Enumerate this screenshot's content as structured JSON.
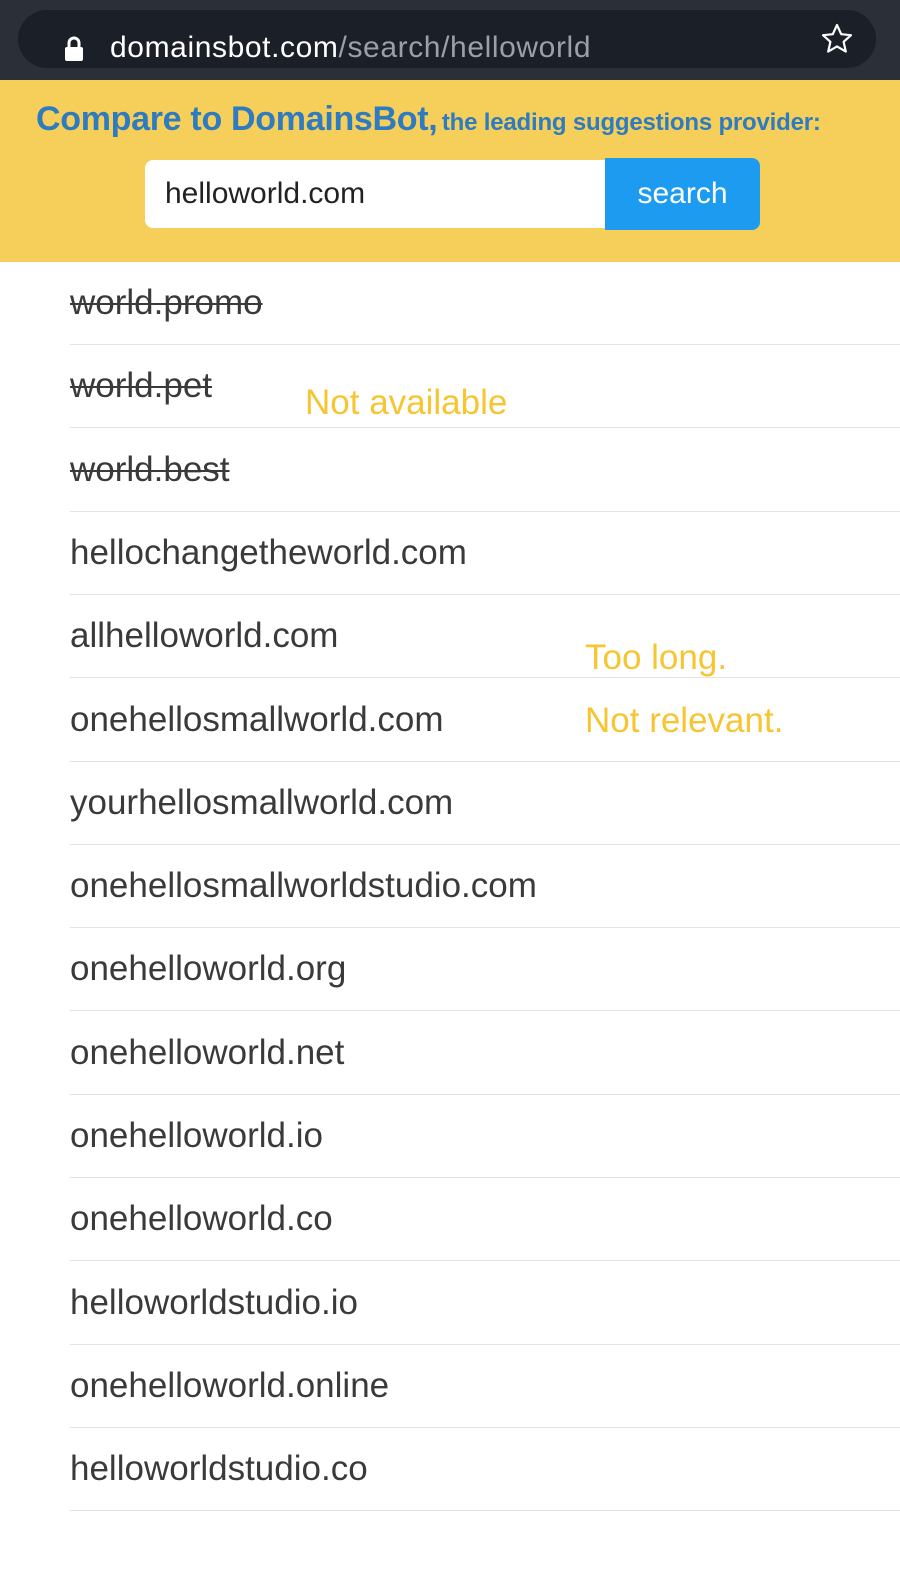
{
  "browser": {
    "url_domain": "domainsbot.com",
    "url_path": "/search/helloworld"
  },
  "banner": {
    "heading_main": "Compare to DomainsBot,",
    "heading_sub": "the leading suggestions provider:",
    "search_value": "helloworld.com",
    "search_button_label": "search"
  },
  "results": [
    {
      "text": "world.promo",
      "struck": true
    },
    {
      "text": "world.pet",
      "struck": true
    },
    {
      "text": "world.best",
      "struck": true
    },
    {
      "text": "hellochangetheworld.com",
      "struck": false
    },
    {
      "text": "allhelloworld.com",
      "struck": false
    },
    {
      "text": "onehellosmallworld.com",
      "struck": false
    },
    {
      "text": "yourhellosmallworld.com",
      "struck": false
    },
    {
      "text": "onehellosmallworldstudio.com",
      "struck": false
    },
    {
      "text": "onehelloworld.org",
      "struck": false
    },
    {
      "text": "onehelloworld.net",
      "struck": false
    },
    {
      "text": "onehelloworld.io",
      "struck": false
    },
    {
      "text": "onehelloworld.co",
      "struck": false
    },
    {
      "text": "helloworldstudio.io",
      "struck": false
    },
    {
      "text": "onehelloworld.online",
      "struck": false
    },
    {
      "text": "helloworldstudio.co",
      "struck": false
    }
  ],
  "annotations": {
    "not_available": "Not available",
    "too_long": "Too long.",
    "not_relevant": "Not relevant."
  },
  "colors": {
    "banner_bg": "#f6cf5a",
    "heading": "#2e7bbf",
    "button": "#1d9bf0",
    "annotation": "#f7c531"
  },
  "icons": [
    "lock-icon",
    "star-icon"
  ]
}
